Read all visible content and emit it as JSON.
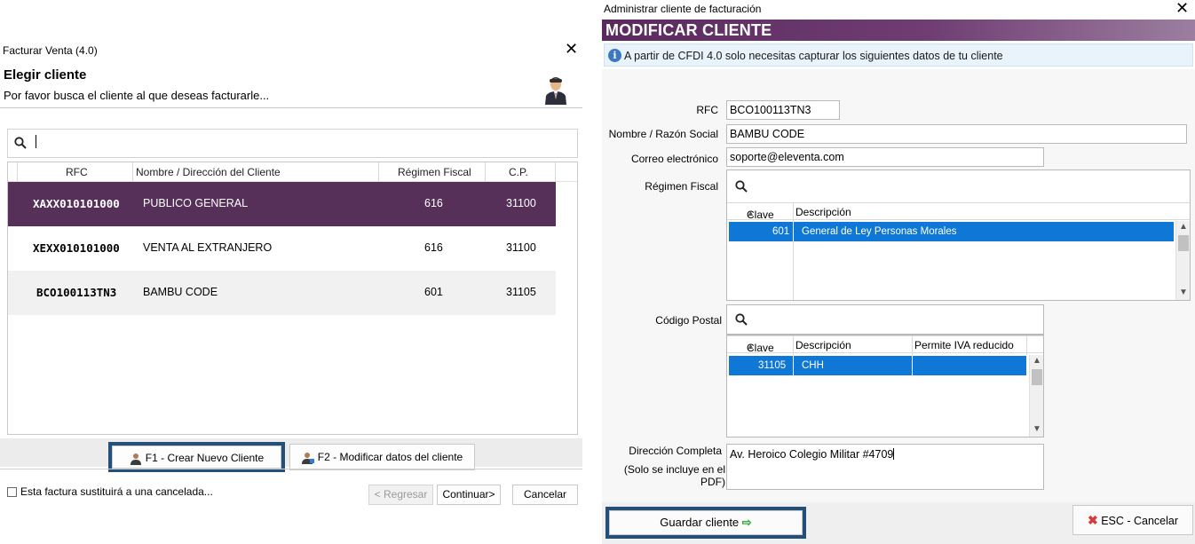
{
  "left_dialog": {
    "window_title": "Facturar Venta (4.0)",
    "heading": "Elegir cliente",
    "subheading": "Por favor busca el cliente al que deseas facturarle...",
    "search": {
      "value": "",
      "placeholder": ""
    },
    "columns": [
      "RFC",
      "Nombre / Dirección del Cliente",
      "Régimen Fiscal",
      "C.P."
    ],
    "rows": [
      {
        "rfc": "XAXX010101000",
        "name": "PUBLICO GENERAL",
        "regimen": "616",
        "cp": "31100",
        "selected": true
      },
      {
        "rfc": "XEXX010101000",
        "name": "VENTA AL EXTRANJERO",
        "regimen": "616",
        "cp": "31100",
        "selected": false
      },
      {
        "rfc": "BCO100113TN3",
        "name": "BAMBU CODE",
        "regimen": "601",
        "cp": "31105",
        "selected": false
      }
    ],
    "buttons": {
      "new_client": "F1 - Crear Nuevo Cliente",
      "modify_client": "F2  - Modificar datos del cliente",
      "back": "< Regresar",
      "continue": "Continuar>",
      "cancel": "Cancelar"
    },
    "checkbox_label": "Esta factura sustituirá a una cancelada..."
  },
  "right_dialog": {
    "window_title": "Administrar cliente de facturación",
    "banner": "MODIFICAR CLIENTE",
    "info": "A partir de CFDI 4.0 solo necesitas capturar los siguientes datos de tu cliente",
    "labels": {
      "rfc": "RFC",
      "nombre": "Nombre / Razón Social",
      "correo": "Correo electrónico",
      "regimen": "Régimen Fiscal",
      "cp": "Código Postal",
      "direccion": "Dirección Completa",
      "direccion_note": "(Solo se incluye en el PDF)"
    },
    "values": {
      "rfc": "BCO100113TN3",
      "nombre": "BAMBU CODE",
      "correo": "soporte@eleventa.com",
      "direccion": "Av. Heroico Colegio Militar #4709"
    },
    "regimen_table": {
      "columns": [
        "Clave",
        "Descripción"
      ],
      "rows": [
        {
          "clave": "601",
          "descripcion": "General de Ley Personas Morales"
        }
      ]
    },
    "cp_table": {
      "columns": [
        "Clave",
        "Descripción",
        "Permite IVA reducido"
      ],
      "rows": [
        {
          "clave": "31105",
          "descripcion": "CHH",
          "iva": ""
        }
      ]
    },
    "buttons": {
      "save": "Guardar cliente",
      "cancel": "ESC - Cancelar"
    }
  },
  "colors": {
    "selected_row": "#57305a",
    "banner": "#5a2a5e",
    "selection_blue": "#0f78d6",
    "focus_frame": "#234f7b"
  }
}
